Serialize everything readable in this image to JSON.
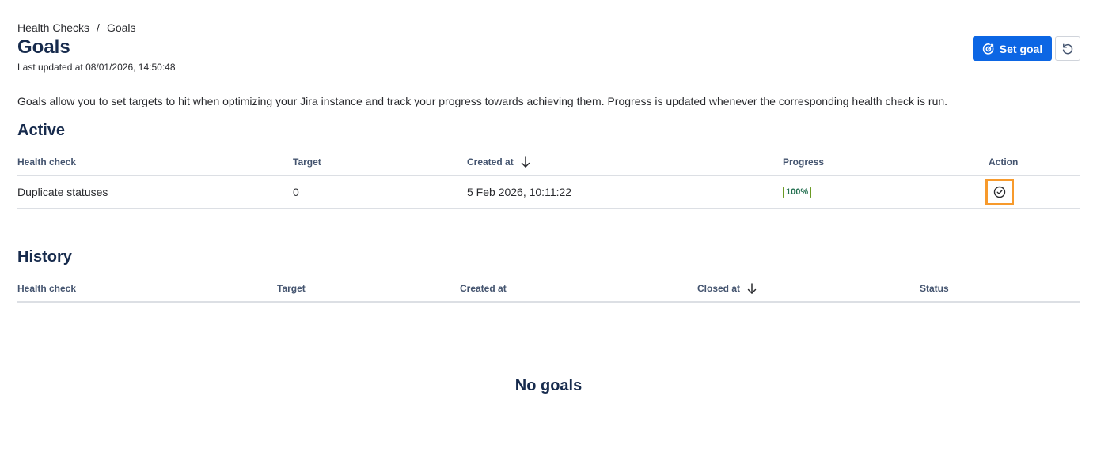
{
  "breadcrumb": {
    "items": [
      "Health Checks",
      "Goals"
    ],
    "separator": "/"
  },
  "header": {
    "title": "Goals",
    "last_updated": "Last updated at 08/01/2026, 14:50:48",
    "set_goal_label": "Set goal",
    "set_goal_icon": "target-icon",
    "refresh_icon": "refresh-icon"
  },
  "description": "Goals allow you to set targets to hit when optimizing your Jira instance and track your progress towards achieving them. Progress is updated whenever the corresponding health check is run.",
  "active": {
    "title": "Active",
    "columns": [
      "Health check",
      "Target",
      "Created at",
      "Progress",
      "Action"
    ],
    "sort_column": "Created at",
    "sort_icon": "arrow-down-icon",
    "rows": [
      {
        "health_check": "Duplicate statuses",
        "target": "0",
        "created_at": "5 Feb 2026, 10:11:22",
        "progress": "100%",
        "action_icon": "check-circle-icon"
      }
    ]
  },
  "history": {
    "title": "History",
    "columns": [
      "Health check",
      "Target",
      "Created at",
      "Closed at",
      "Status"
    ],
    "sort_column": "Closed at",
    "sort_icon": "arrow-down-icon",
    "empty_text": "No goals"
  },
  "colors": {
    "primary": "#0c66e4",
    "highlight": "#f79a2c",
    "success_border": "#6a9a23",
    "divider": "#dcdfe4"
  }
}
